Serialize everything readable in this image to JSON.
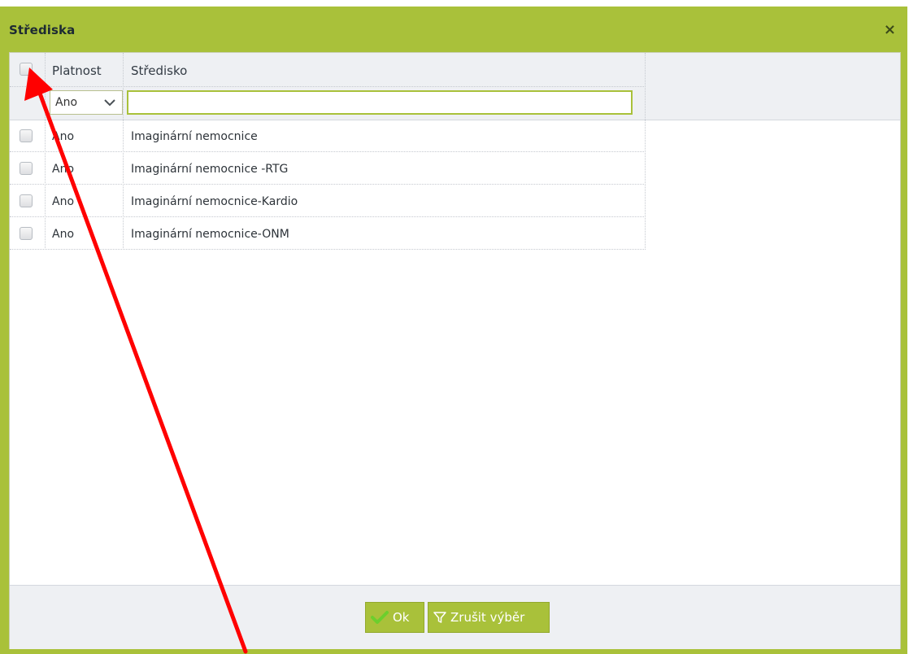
{
  "dialog": {
    "title": "Střediska",
    "close_label": "×"
  },
  "grid": {
    "columns": [
      "Platnost",
      "Středisko"
    ],
    "filter": {
      "platnost_value": "Ano",
      "stredisko_value": ""
    },
    "rows": [
      {
        "platnost": "Ano",
        "stredisko": "Imaginární nemocnice"
      },
      {
        "platnost": "Ano",
        "stredisko": "Imaginární nemocnice -RTG"
      },
      {
        "platnost": "Ano",
        "stredisko": "Imaginární nemocnice-Kardio"
      },
      {
        "platnost": "Ano",
        "stredisko": "Imaginární nemocnice-ONM"
      }
    ]
  },
  "footer": {
    "ok_label": "Ok",
    "clear_label": "Zrušit výběr"
  },
  "colors": {
    "accent": "#a9c13a",
    "annotation_arrow": "#ff0000"
  },
  "icons": {
    "close": "close-icon",
    "dropdown": "chevron-down-icon",
    "ok": "checkmark-icon",
    "clear": "filter-icon"
  }
}
